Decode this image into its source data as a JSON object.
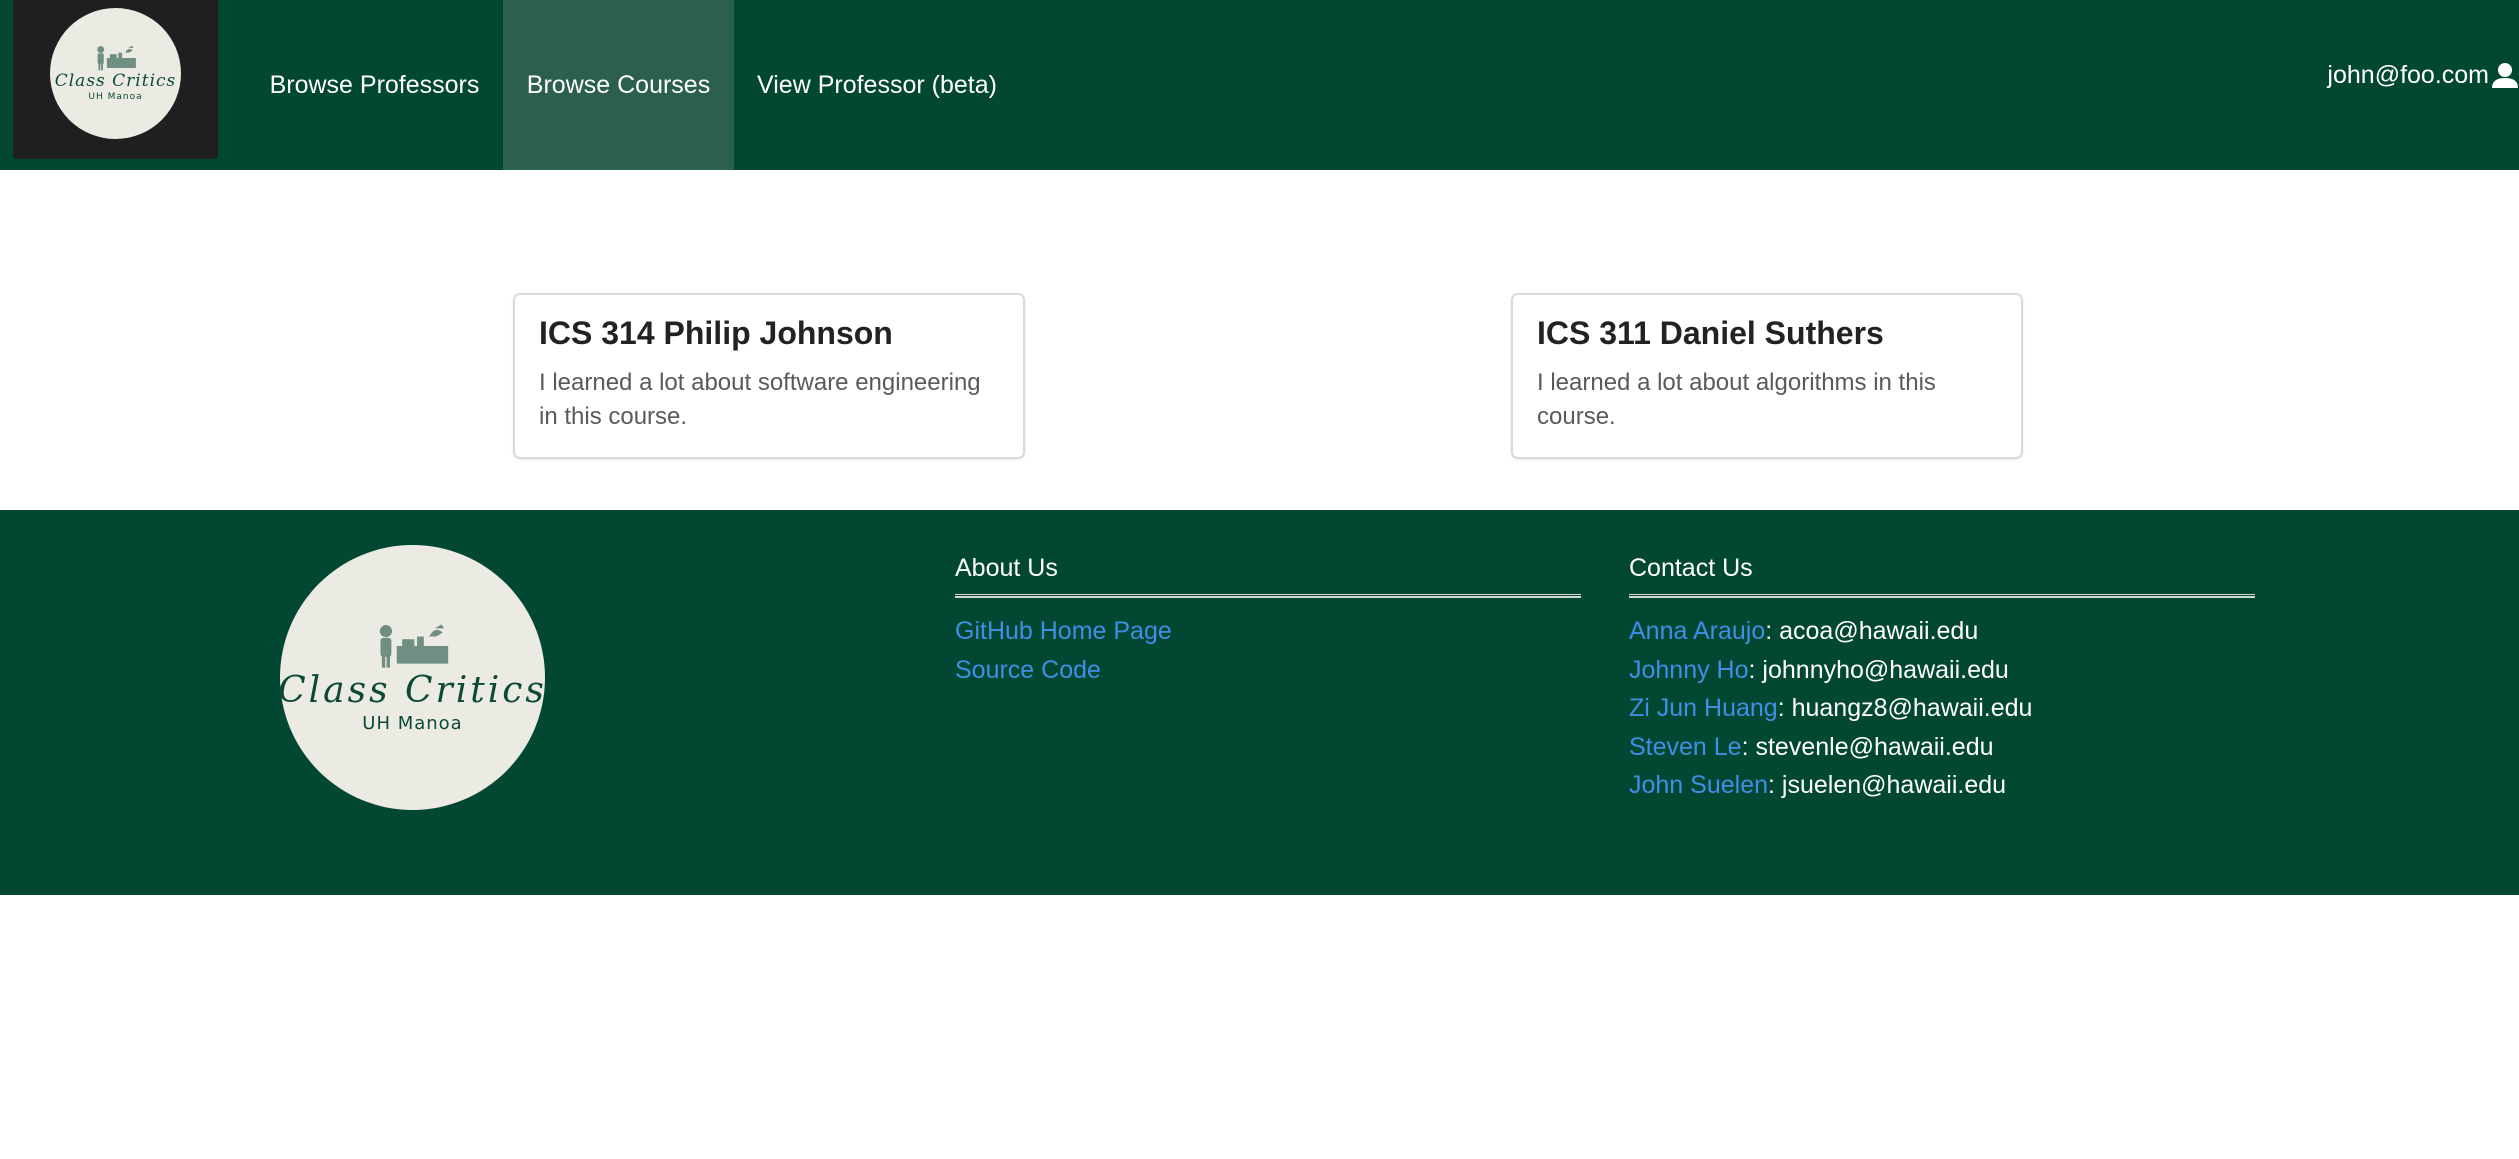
{
  "navbar": {
    "logo": {
      "title": "Class Critics",
      "subtitle": "UH Manoa"
    },
    "links": [
      {
        "label": "Browse Professors",
        "active": false
      },
      {
        "label": "Browse Courses",
        "active": true
      },
      {
        "label": "View Professor (beta)",
        "active": false
      }
    ],
    "user": {
      "email": "john@foo.com",
      "icon": "user-icon"
    },
    "colors": {
      "background": "#024731",
      "active_tab": "#2d5f50",
      "logo_panel": "#1f1f1f"
    }
  },
  "reviews": [
    {
      "title": "ICS 314 Philip Johnson",
      "text": "I learned a lot about software engineering in this course."
    },
    {
      "title": "ICS 311 Daniel Suthers",
      "text": "I learned a lot about algorithms in this course."
    }
  ],
  "footer": {
    "logo": {
      "title": "Class Critics",
      "subtitle": "UH Manoa"
    },
    "about": {
      "heading": "About Us",
      "links": [
        {
          "label": "GitHub Home Page"
        },
        {
          "label": "Source Code"
        }
      ]
    },
    "contact": {
      "heading": "Contact Us",
      "people": [
        {
          "name": "Anna Araujo",
          "email": ": acoa@hawaii.edu"
        },
        {
          "name": "Johnny Ho",
          "email": ": johnnyho@hawaii.edu"
        },
        {
          "name": "Zi Jun Huang",
          "email": ": huangz8@hawaii.edu"
        },
        {
          "name": "Steven Le",
          "email": ": stevenle@hawaii.edu"
        },
        {
          "name": "John Suelen",
          "email": ": jsuelen@hawaii.edu"
        }
      ]
    },
    "colors": {
      "background": "#024731",
      "link": "#3f8fe6"
    }
  }
}
